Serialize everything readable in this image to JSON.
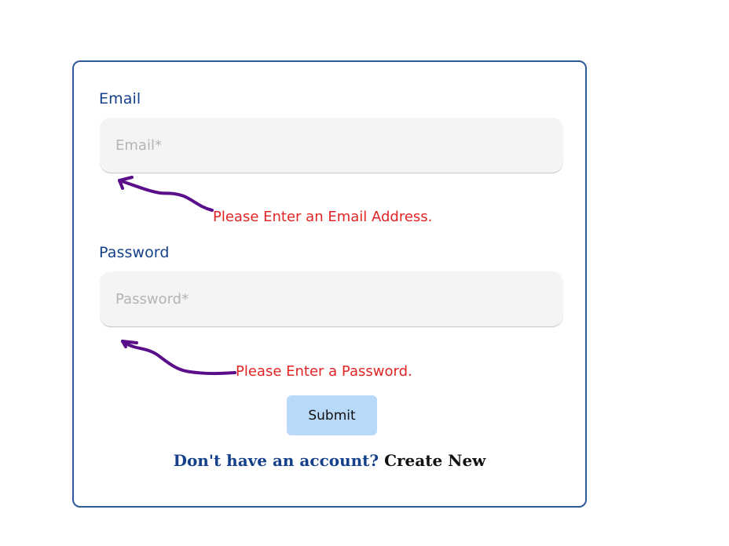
{
  "form": {
    "email": {
      "label": "Email",
      "placeholder": "Email*",
      "value": "",
      "error": "Please Enter an Email Address."
    },
    "password": {
      "label": "Password",
      "placeholder": "Password*",
      "value": "",
      "error": "Please Enter a Password."
    },
    "submit_label": "Submit",
    "footer": {
      "question": "Don't have an account?",
      "link_label": "Create New"
    }
  },
  "colors": {
    "label": "#15408a",
    "error": "#e32424",
    "annotation": "#5a0e8a",
    "submit_bg": "#b9d9f9",
    "card_border": "#2d5a9b"
  }
}
